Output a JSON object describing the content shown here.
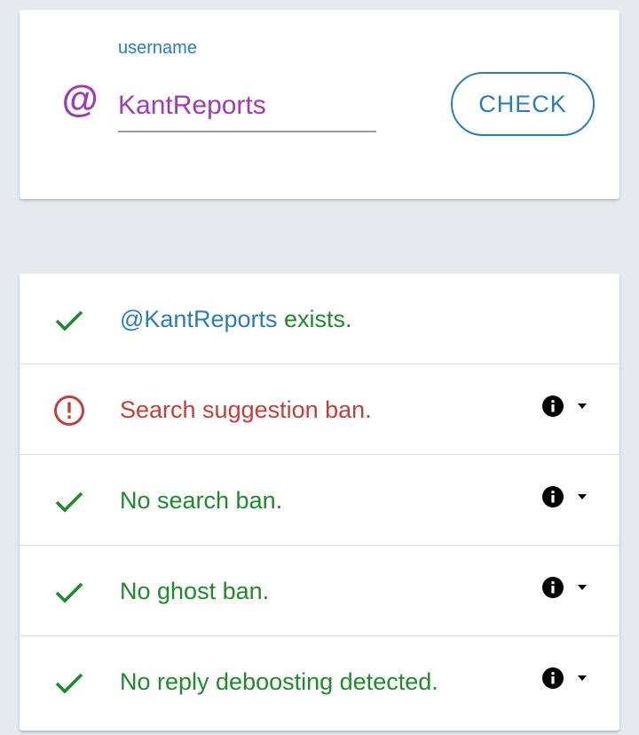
{
  "search": {
    "label": "username",
    "at_symbol": "@",
    "value": "KantReports",
    "button_label": "CHECK"
  },
  "colors": {
    "accent_purple": "#9c3db0",
    "accent_blue": "#2a7fb0",
    "ok_green": "#1e8a2a",
    "error_red": "#c0413b",
    "page_background": "#e6eaee"
  },
  "results": {
    "exists": {
      "status": "ok",
      "icon": "check-icon",
      "handle": "@KantReports",
      "text": " exists."
    },
    "items": [
      {
        "status": "error",
        "icon": "alert-circle-icon",
        "text": "Search suggestion ban.",
        "info_icon": "info-icon",
        "toggle_icon": "caret-down-icon"
      },
      {
        "status": "ok",
        "icon": "check-icon",
        "text": "No search ban.",
        "info_icon": "info-icon",
        "toggle_icon": "caret-down-icon"
      },
      {
        "status": "ok",
        "icon": "check-icon",
        "text": "No ghost ban.",
        "info_icon": "info-icon",
        "toggle_icon": "caret-down-icon"
      },
      {
        "status": "ok",
        "icon": "check-icon",
        "text": "No reply deboosting detected.",
        "info_icon": "info-icon",
        "toggle_icon": "caret-down-icon"
      }
    ]
  }
}
